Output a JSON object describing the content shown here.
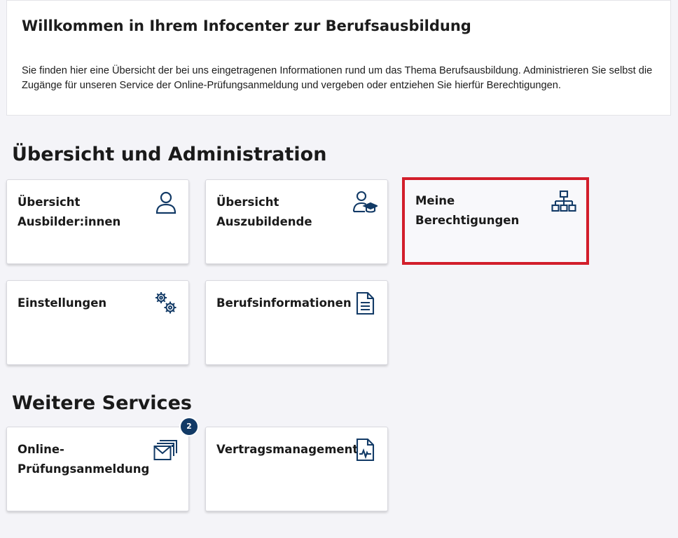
{
  "welcome": {
    "title": "Willkommen in Ihrem Infocenter zur Berufsausbildung",
    "text": "Sie finden hier eine Übersicht der bei uns eingetragenen Informationen rund um das Thema Berufsausbildung. Administrieren Sie selbst die Zugänge für unseren Service der Online-Prüfungsanmeldung und vergeben oder entziehen Sie hierfür Berechtigungen."
  },
  "sections": {
    "admin": {
      "title": "Übersicht und Administration",
      "tiles": [
        {
          "label": "Übersicht Ausbilder:in­nen",
          "icon": "person-icon"
        },
        {
          "label": "Übersicht Auszubilden­de",
          "icon": "graduate-icon"
        },
        {
          "label": "Meine Berechtigungen",
          "icon": "hierarchy-icon"
        },
        {
          "label": "Einstellungen",
          "icon": "gears-icon"
        },
        {
          "label": "Berufsinformationen",
          "icon": "document-icon"
        }
      ]
    },
    "services": {
      "title": "Weitere Services",
      "tiles": [
        {
          "label": "Online-Prüfungsanmeldung",
          "icon": "mail-stack-icon",
          "badge": "2"
        },
        {
          "label": "Vertragsmanagement",
          "icon": "contract-document-icon"
        }
      ]
    }
  },
  "colors": {
    "icon": "#123a66",
    "highlight": "#d21e2b",
    "badge": "#123a66"
  }
}
